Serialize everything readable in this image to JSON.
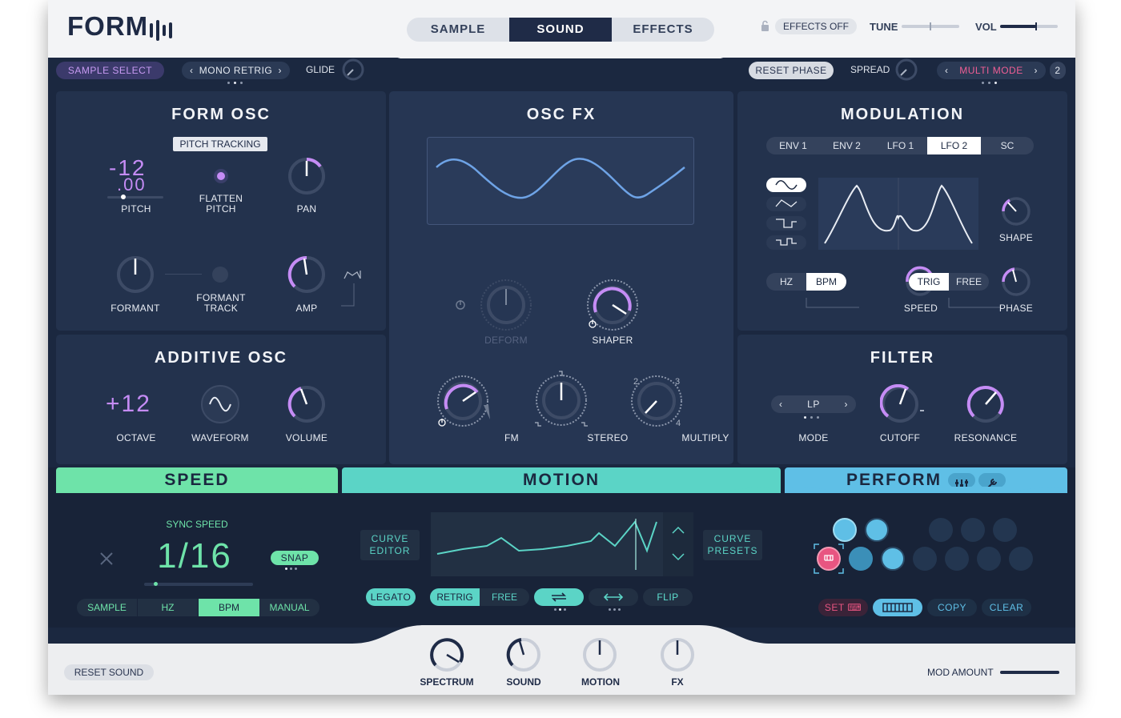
{
  "brand": {
    "name": "FORM"
  },
  "header": {
    "tabs": [
      {
        "label": "SAMPLE"
      },
      {
        "label": "SOUND"
      },
      {
        "label": "EFFECTS"
      }
    ],
    "effects_off": "EFFECTS OFF",
    "tune_label": "TUNE",
    "vol_label": "VOL",
    "vol_level": 0.62,
    "tune_level": 0.5
  },
  "subheader": {
    "sample_select": "SAMPLE SELECT",
    "mono_retrig": "MONO RETRIG",
    "glide": "GLIDE",
    "reset_phase": "RESET PHASE",
    "spread": "SPREAD",
    "multi_mode": "MULTI MODE",
    "multi_count": "2"
  },
  "form_osc": {
    "title": "FORM OSC",
    "pitch_tracking": "PITCH TRACKING",
    "pitch_value": "-12",
    "pitch_fine": ".00",
    "pitch": "PITCH",
    "flatten_pitch_1": "FLATTEN",
    "flatten_pitch_2": "PITCH",
    "pan": "PAN",
    "formant": "FORMANT",
    "formant_track_1": "FORMANT",
    "formant_track_2": "TRACK",
    "amp": "AMP"
  },
  "additive_osc": {
    "title": "ADDITIVE OSC",
    "octave_value": "+12",
    "octave": "OCTAVE",
    "waveform": "WAVEFORM",
    "volume": "VOLUME"
  },
  "osc_fx": {
    "title": "OSC FX",
    "deform": "DEFORM",
    "shaper": "SHAPER",
    "fm": "FM",
    "stereo": "STEREO",
    "multiply": "MULTIPLY",
    "multiply_ticks": [
      "2",
      "3",
      "4"
    ]
  },
  "modulation": {
    "title": "MODULATION",
    "tabs": [
      {
        "label": "ENV 1"
      },
      {
        "label": "ENV 2"
      },
      {
        "label": "LFO 1"
      },
      {
        "label": "LFO 2"
      },
      {
        "label": "SC"
      }
    ],
    "selected_tab": "LFO 2",
    "shape": "SHAPE",
    "hz": "HZ",
    "bpm": "BPM",
    "speed": "SPEED",
    "trig": "TRIG",
    "free": "FREE",
    "phase": "PHASE",
    "lfo_waveforms": [
      "sine-icon",
      "triangle-icon",
      "square-icon",
      "step-icon"
    ]
  },
  "filter": {
    "title": "FILTER",
    "mode_value": "LP",
    "mode": "MODE",
    "cutoff": "CUTOFF",
    "resonance": "RESONANCE"
  },
  "speed": {
    "title": "SPEED",
    "sync_speed": "SYNC SPEED",
    "value": "1/16",
    "snap": "SNAP",
    "modes": [
      {
        "label": "SAMPLE"
      },
      {
        "label": "HZ"
      },
      {
        "label": "BPM"
      },
      {
        "label": "MANUAL"
      }
    ],
    "selected_mode": "BPM"
  },
  "motion": {
    "title": "MOTION",
    "curve_editor_1": "CURVE",
    "curve_editor_2": "EDITOR",
    "curve_presets_1": "CURVE",
    "curve_presets_2": "PRESETS",
    "legato": "LEGATO",
    "retrig": "RETRIG",
    "free": "FREE",
    "flip": "FLIP"
  },
  "perform": {
    "title": "PERFORM",
    "set": "SET",
    "copy": "COPY",
    "clear": "CLEAR"
  },
  "footer": {
    "reset_sound": "RESET SOUND",
    "macros": [
      {
        "label": "SPECTRUM"
      },
      {
        "label": "SOUND"
      },
      {
        "label": "MOTION"
      },
      {
        "label": "FX"
      }
    ],
    "mod_amount": "MOD AMOUNT",
    "mod_amount_level": 1.0
  },
  "colors": {
    "accent_purple": "#c58cf5",
    "speed_green": "#6ee3a9",
    "motion_teal": "#5bd4c6",
    "perform_blue": "#5fbfe6",
    "panel": "#23324d",
    "background": "#1b2840"
  }
}
